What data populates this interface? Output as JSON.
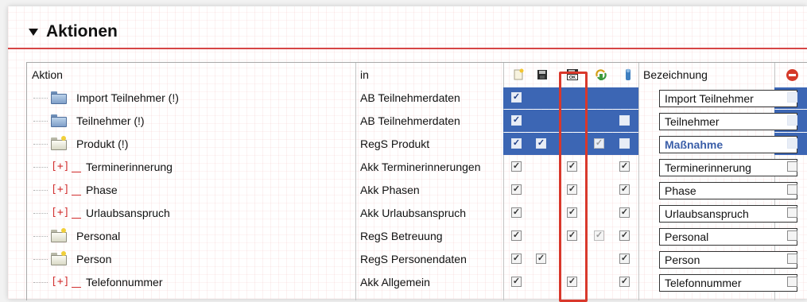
{
  "section": {
    "title": "Aktionen"
  },
  "columns": {
    "aktion": "Aktion",
    "in": "in",
    "bezeichnung": "Bezeichnung"
  },
  "header_icons": [
    "new-document-icon",
    "save-icon",
    "save-ok-icon",
    "refresh-icon",
    "user-icon",
    "no-entry-icon"
  ],
  "colors": {
    "accent": "#d9382b",
    "selection": "#3c66b4"
  },
  "rows": [
    {
      "aktion": "Import Teilnehmer (!)",
      "in": "AB Teilnehmerdaten",
      "bezeichnung": "Import Teilnehmer",
      "icon": "folder-blue-icon",
      "selected": true
    },
    {
      "aktion": "Teilnehmer (!)",
      "in": "AB Teilnehmerdaten",
      "bezeichnung": "Teilnehmer",
      "icon": "folder-blue-icon",
      "selected": true
    },
    {
      "aktion": "Produkt (!)",
      "in": "RegS Produkt",
      "bezeichnung": "Maßnahme",
      "icon": "folder-icon",
      "selected": true
    },
    {
      "aktion": "Terminerinnerung",
      "in": "Akk Terminerinnerungen",
      "bezeichnung": "Terminerinnerung",
      "icon": "expand-plus-icon"
    },
    {
      "aktion": "Phase",
      "in": "Akk Phasen",
      "bezeichnung": "Phase",
      "icon": "expand-plus-icon"
    },
    {
      "aktion": "Urlaubsanspruch",
      "in": "Akk Urlaubsanspruch",
      "bezeichnung": "Urlaubsanspruch",
      "icon": "expand-plus-icon"
    },
    {
      "aktion": "Personal",
      "in": "RegS Betreuung",
      "bezeichnung": "Personal",
      "icon": "folder-icon"
    },
    {
      "aktion": "Person",
      "in": "RegS Personendaten",
      "bezeichnung": "Person",
      "icon": "folder-icon"
    },
    {
      "aktion": "Telefonnummer",
      "in": "Akk Allgemein",
      "bezeichnung": "Telefonnummer",
      "icon": "expand-plus-icon"
    }
  ],
  "plus_glyph": "[+]"
}
